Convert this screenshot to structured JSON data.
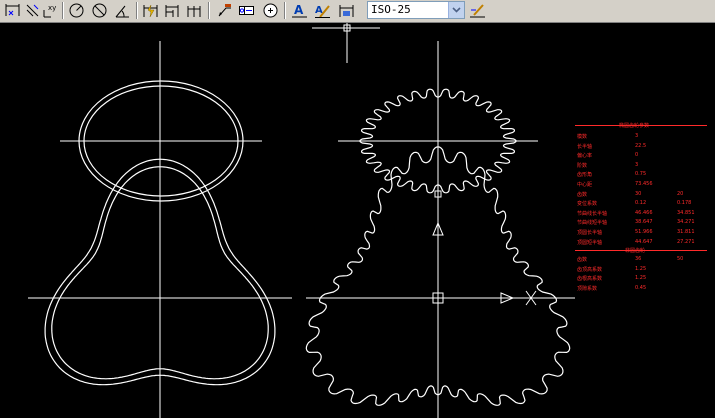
{
  "toolbar": {
    "buttons": [
      {
        "name": "linear-dim-icon"
      },
      {
        "name": "aligned-dim-icon"
      },
      {
        "name": "ordinate-dim-icon"
      },
      {
        "name": "radius-dim-icon"
      },
      {
        "name": "diameter-dim-icon"
      },
      {
        "name": "angular-dim-icon"
      },
      {
        "name": "quick-dim-icon"
      },
      {
        "name": "baseline-dim-icon"
      },
      {
        "name": "continue-dim-icon"
      },
      {
        "name": "leader-icon"
      },
      {
        "name": "tolerance-icon"
      },
      {
        "name": "center-mark-icon"
      },
      {
        "name": "dim-edit-icon"
      },
      {
        "name": "dim-text-edit-icon"
      },
      {
        "name": "dim-update-icon"
      },
      {
        "name": "dim-style-icon"
      }
    ],
    "dim_style": {
      "value": "ISO-25"
    }
  },
  "param_table": {
    "title": "椭圆齿轮参数",
    "rows": [
      [
        "模数",
        "3",
        ""
      ],
      [
        "长半轴",
        "22.5",
        ""
      ],
      [
        "偏心率",
        "0",
        ""
      ],
      [
        "阶数",
        "3",
        ""
      ],
      [
        "齿形角",
        "0.75",
        ""
      ],
      [
        "中心距",
        "73.456",
        ""
      ],
      [
        "齿数",
        "30",
        "20"
      ],
      [
        "变位系数",
        "0.12",
        "0.178"
      ],
      [
        "节曲线长半轴",
        "46.466",
        "34.851"
      ],
      [
        "节曲线短半轴",
        "38.647",
        "34.271"
      ],
      [
        "顶圆长半轴",
        "51.966",
        "31.811"
      ],
      [
        "顶圆短半轴",
        "44.647",
        "27.271"
      ]
    ],
    "subtitle": "非圆齿轮",
    "rows2": [
      [
        "齿数",
        "36",
        "50"
      ],
      [
        "齿顶高系数",
        "1.25",
        ""
      ],
      [
        "齿根高系数",
        "1.25",
        ""
      ],
      [
        "顶隙系数",
        "0.45",
        ""
      ]
    ]
  },
  "colors": {
    "drawing": "#ffffff",
    "annotation": "#ff2a2a",
    "toolbar": "#d4d0c8"
  }
}
